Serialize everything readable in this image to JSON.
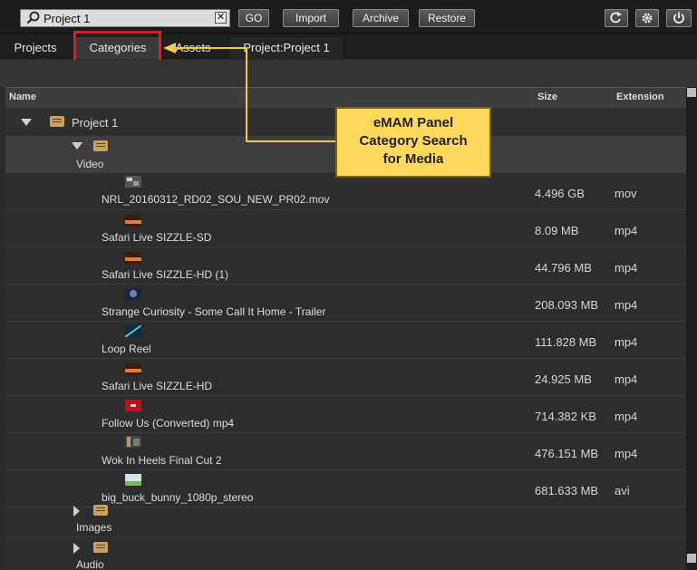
{
  "toolbar": {
    "search_value": "Project 1",
    "clear_glyph": "✕",
    "buttons": [
      "GO",
      "Import",
      "Archive",
      "Restore"
    ],
    "icons": [
      "refresh-icon",
      "settings-gear-icon",
      "power-icon"
    ]
  },
  "tabs": [
    "Projects",
    "Categories",
    "Assets",
    "Project:Project 1"
  ],
  "table": {
    "columns": [
      "Name",
      "Size",
      "Extension"
    ],
    "project": "Project 1",
    "category_video": "Video",
    "assets": [
      {
        "name": "NRL_20160312_RD02_SOU_NEW_PR02.mov",
        "size": "4.496 GB",
        "ext": "mov"
      },
      {
        "name": "Safari Live SIZZLE-SD",
        "size": "8.09 MB",
        "ext": "mp4"
      },
      {
        "name": "Safari Live SIZZLE-HD (1)",
        "size": "44.796 MB",
        "ext": "mp4"
      },
      {
        "name": "Strange Curiosity - Some Call It Home - Trailer",
        "size": "208.093 MB",
        "ext": "mp4"
      },
      {
        "name": "Loop Reel",
        "size": "111.828 MB",
        "ext": "mp4"
      },
      {
        "name": "Safari Live SIZZLE-HD",
        "size": "24.925 MB",
        "ext": "mp4"
      },
      {
        "name": "Follow Us (Converted) mp4",
        "size": "714.382 KB",
        "ext": "mp4"
      },
      {
        "name": "Wok In Heels Final Cut 2",
        "size": "476.151 MB",
        "ext": "mp4"
      },
      {
        "name": "big_buck_bunny_1080p_stereo",
        "size": "681.633 MB",
        "ext": "avi"
      }
    ],
    "category_images": "Images",
    "category_audio": "Audio"
  },
  "callout": {
    "line1": "eMAM Panel",
    "line2": "Category Search",
    "line3": "for Media"
  },
  "colors": {
    "callout_bg": "#ffd85c",
    "highlight": "#d81e1e",
    "folder": "#c9a25f"
  }
}
